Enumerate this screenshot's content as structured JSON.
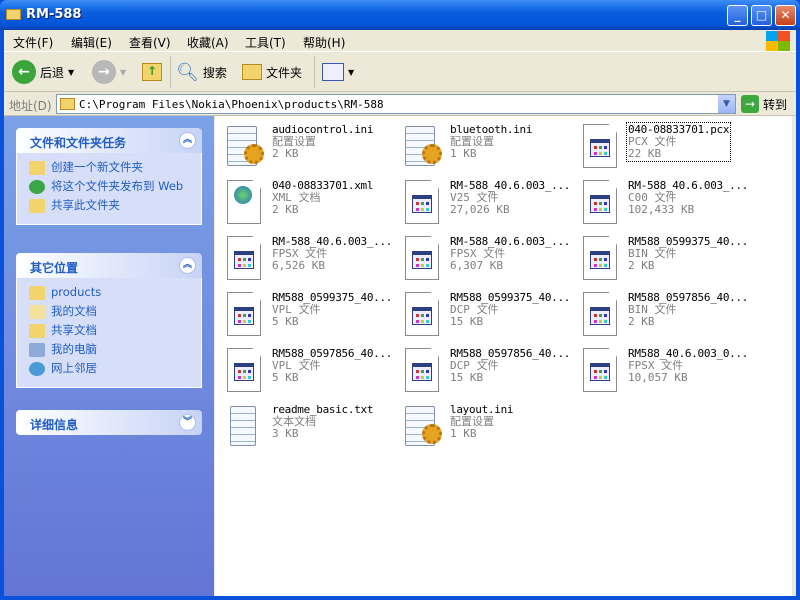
{
  "window": {
    "title": "RM-588"
  },
  "menu": [
    "文件(F)",
    "编辑(E)",
    "查看(V)",
    "收藏(A)",
    "工具(T)",
    "帮助(H)"
  ],
  "toolbar": {
    "back": "后退",
    "search": "搜索",
    "folders": "文件夹"
  },
  "address": {
    "label": "地址(D)",
    "path": "C:\\Program Files\\Nokia\\Phoenix\\products\\RM-588",
    "go": "转到"
  },
  "panels": {
    "tasks": {
      "title": "文件和文件夹任务",
      "items": [
        "创建一个新文件夹",
        "将这个文件夹发布到 Web",
        "共享此文件夹"
      ]
    },
    "places": {
      "title": "其它位置",
      "items": [
        "products",
        "我的文档",
        "共享文档",
        "我的电脑",
        "网上邻居"
      ]
    },
    "details": {
      "title": "详细信息"
    }
  },
  "files": [
    {
      "name": "audiocontrol.ini",
      "type": "配置设置",
      "size": "2 KB",
      "icon": "ini"
    },
    {
      "name": "bluetooth.ini",
      "type": "配置设置",
      "size": "1 KB",
      "icon": "ini"
    },
    {
      "name": "040-08833701.pcx",
      "type": "PCX 文件",
      "size": "22 KB",
      "icon": "generic"
    },
    {
      "name": "040-08833701.xml",
      "type": "XML 文档",
      "size": "2 KB",
      "icon": "xml"
    },
    {
      "name": "RM-588_40.6.003_...",
      "type": "V25 文件",
      "size": "27,026 KB",
      "icon": "generic"
    },
    {
      "name": "RM-588_40.6.003_...",
      "type": "C00 文件",
      "size": "102,433 KB",
      "icon": "generic"
    },
    {
      "name": "RM-588_40.6.003_...",
      "type": "FPSX 文件",
      "size": "6,526 KB",
      "icon": "generic"
    },
    {
      "name": "RM-588_40.6.003_...",
      "type": "FPSX 文件",
      "size": "6,307 KB",
      "icon": "generic"
    },
    {
      "name": "RM588_0599375_40...",
      "type": "BIN 文件",
      "size": "2 KB",
      "icon": "generic"
    },
    {
      "name": "RM588_0599375_40...",
      "type": "VPL 文件",
      "size": "5 KB",
      "icon": "generic"
    },
    {
      "name": "RM588_0599375_40...",
      "type": "DCP 文件",
      "size": "15 KB",
      "icon": "generic"
    },
    {
      "name": "RM588_0597856_40...",
      "type": "BIN 文件",
      "size": "2 KB",
      "icon": "generic"
    },
    {
      "name": "RM588_0597856_40...",
      "type": "VPL 文件",
      "size": "5 KB",
      "icon": "generic"
    },
    {
      "name": "RM588_0597856_40...",
      "type": "DCP 文件",
      "size": "15 KB",
      "icon": "generic"
    },
    {
      "name": "RM588_40.6.003_0...",
      "type": "FPSX 文件",
      "size": "10,057 KB",
      "icon": "generic"
    },
    {
      "name": "readme_basic.txt",
      "type": "文本文档",
      "size": "3 KB",
      "icon": "txt"
    },
    {
      "name": "layout.ini",
      "type": "配置设置",
      "size": "1 KB",
      "icon": "ini"
    }
  ]
}
